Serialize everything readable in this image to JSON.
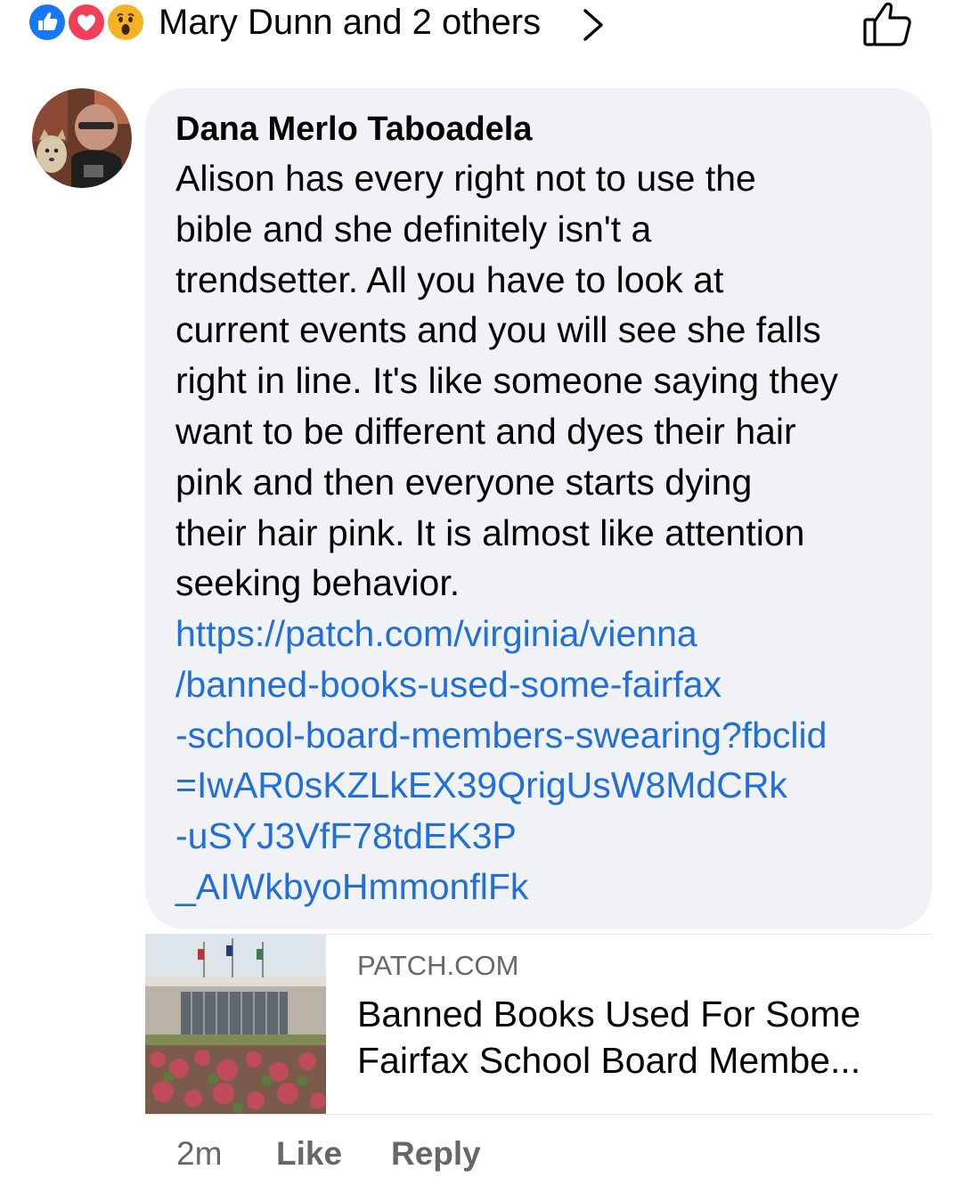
{
  "reactions": {
    "icons": [
      "like-icon",
      "love-icon",
      "wow-icon"
    ],
    "summary": "Mary Dunn and 2 others"
  },
  "comment": {
    "author": "Dana Merlo Taboadela",
    "text_lines": [
      "Alison has every right not to use the",
      "bible and she definitely isn't a",
      "trendsetter. All you have to look at",
      "current events and you will see she falls",
      "right in line. It's like someone saying they",
      "want to be different and dyes their hair",
      "pink and then  everyone starts dying",
      "their hair pink. It is almost like attention",
      "seeking behavior."
    ],
    "link_lines": [
      "https://patch.com/virginia/vienna",
      "/banned-books-used-some-fairfax",
      "-school-board-members-swearing?fbclid",
      "=IwAR0sKZLkEX39QrigUsW8MdCRk",
      "-uSYJ3VfF78tdEK3P",
      "_AIWkbyoHmmonflFk"
    ]
  },
  "link_preview": {
    "domain": "PATCH.COM",
    "title_lines": [
      "Banned Books Used For Some",
      "Fairfax School Board Membe..."
    ]
  },
  "actions": {
    "time": "2m",
    "like": "Like",
    "reply": "Reply"
  },
  "colors": {
    "link": "#216fdb",
    "bubble": "#f0f2f5",
    "meta": "#65676b",
    "like_blue": "#1877f2",
    "love_red": "#f33e58",
    "wow_yellow": "#f7b125"
  }
}
